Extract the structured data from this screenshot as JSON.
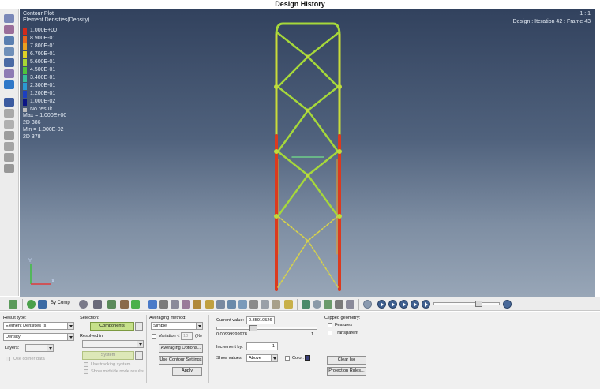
{
  "window": {
    "title": "Design History"
  },
  "viewport": {
    "plot_title": "Contour Plot",
    "plot_subtitle": "Element Densities(Density)",
    "page_indicator": "1 : 1",
    "design_status": "Design : Iteration 42 : Frame 43",
    "legend": [
      {
        "label": "1.000E+00",
        "color": "#d42a1a"
      },
      {
        "label": "8.900E-01",
        "color": "#e8641c"
      },
      {
        "label": "7.800E-01",
        "color": "#eaa020"
      },
      {
        "label": "6.700E-01",
        "color": "#e0d226"
      },
      {
        "label": "5.600E-01",
        "color": "#a8d834"
      },
      {
        "label": "4.500E-01",
        "color": "#4fc63a"
      },
      {
        "label": "3.400E-01",
        "color": "#36c09a"
      },
      {
        "label": "2.300E-01",
        "color": "#2a9ad4"
      },
      {
        "label": "1.200E-01",
        "color": "#1c3fc2"
      },
      {
        "label": "1.000E-02",
        "color": "#0b1585"
      }
    ],
    "no_result_label": "No result",
    "no_result_color": "#bcbcbc",
    "max_label": "Max = 1.000E+00",
    "max_elem": "2D 386",
    "min_label": "Min = 1.000E-02",
    "min_elem": "2D 378",
    "axis_y": "Y",
    "axis_x": "X"
  },
  "toolbar": {
    "by_comp_label": "By Comp"
  },
  "panel": {
    "result_type": {
      "label": "Result type:",
      "value": "Element Densities (s)",
      "component": "Density",
      "layers_label": "Layers:",
      "use_corner_data": "Use corner data"
    },
    "selection": {
      "label": "Selection:",
      "components_button": "Components",
      "resolved_in_label": "Resolved in",
      "system_button": "System",
      "use_tracking_system": "Use tracking system",
      "show_midside": "Show midside node results"
    },
    "averaging": {
      "label": "Averaging method:",
      "value": "Simple",
      "variation_label": "Variation <",
      "variation_value": "10",
      "variation_unit": "(%)",
      "options_button": "Averaging Options...",
      "settings_button": "Use Contour Settings",
      "apply_button": "Apply"
    },
    "current": {
      "label": "Current value:",
      "value": "0.35910526",
      "range_min": "0.00999999978",
      "range_max": "1",
      "increment_label": "Increment by:",
      "increment_value": "1",
      "show_values_label": "Show values:",
      "show_values_value": "Above",
      "color_label": "Color:",
      "slider_fraction": 0.35
    },
    "clipped": {
      "label": "Clipped geometry:",
      "features": "Features",
      "transparent": "Transparent",
      "clear_iso_button": "Clear Iso",
      "projection_rules_button": "Projection Rules..."
    }
  }
}
